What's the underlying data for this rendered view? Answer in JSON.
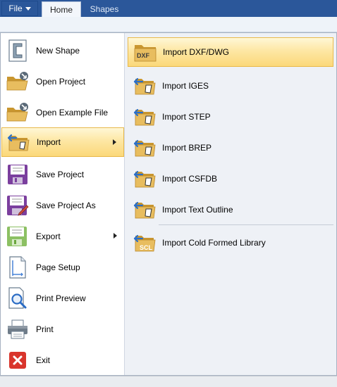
{
  "ribbon": {
    "file_label": "File",
    "tabs": [
      {
        "label": "Home",
        "active": true
      },
      {
        "label": "Shapes",
        "active": false
      }
    ]
  },
  "left_menu": {
    "items": [
      {
        "label": "New Shape",
        "icon": "new-shape-icon"
      },
      {
        "label": "Open Project",
        "icon": "open-folder-icon"
      },
      {
        "label": "Open Example File",
        "icon": "open-example-icon"
      },
      {
        "label": "Import",
        "icon": "import-icon",
        "submenu": true,
        "highlighted": true
      },
      {
        "label": "Save Project",
        "icon": "save-disk-icon"
      },
      {
        "label": "Save Project As",
        "icon": "save-as-icon"
      },
      {
        "label": "Export",
        "icon": "export-icon",
        "submenu": true
      },
      {
        "label": "Page Setup",
        "icon": "page-setup-icon"
      },
      {
        "label": "Print Preview",
        "icon": "print-preview-icon"
      },
      {
        "label": "Print",
        "icon": "printer-icon"
      },
      {
        "label": "Exit",
        "icon": "exit-icon"
      }
    ]
  },
  "import_submenu": {
    "items": [
      {
        "label": "Import DXF/DWG",
        "icon": "dxf-folder-icon",
        "badge": "DXF",
        "highlighted": true
      },
      {
        "label": "Import IGES",
        "icon": "import-folder-icon"
      },
      {
        "label": "Import STEP",
        "icon": "import-folder-icon"
      },
      {
        "label": "Import BREP",
        "icon": "import-folder-icon"
      },
      {
        "label": "Import CSFDB",
        "icon": "import-folder-icon"
      },
      {
        "label": "Import Text Outline",
        "icon": "import-folder-icon"
      },
      {
        "label": "Import Cold Formed Library",
        "icon": "scl-folder-icon",
        "badge": "SCL"
      }
    ]
  },
  "colors": {
    "ribbon_blue": "#2b579a",
    "highlight_top": "#fff7d6",
    "highlight_bottom": "#fbd879",
    "highlight_border": "#e8b94b",
    "folder": "#e2b654",
    "exit_red": "#d9352c"
  }
}
